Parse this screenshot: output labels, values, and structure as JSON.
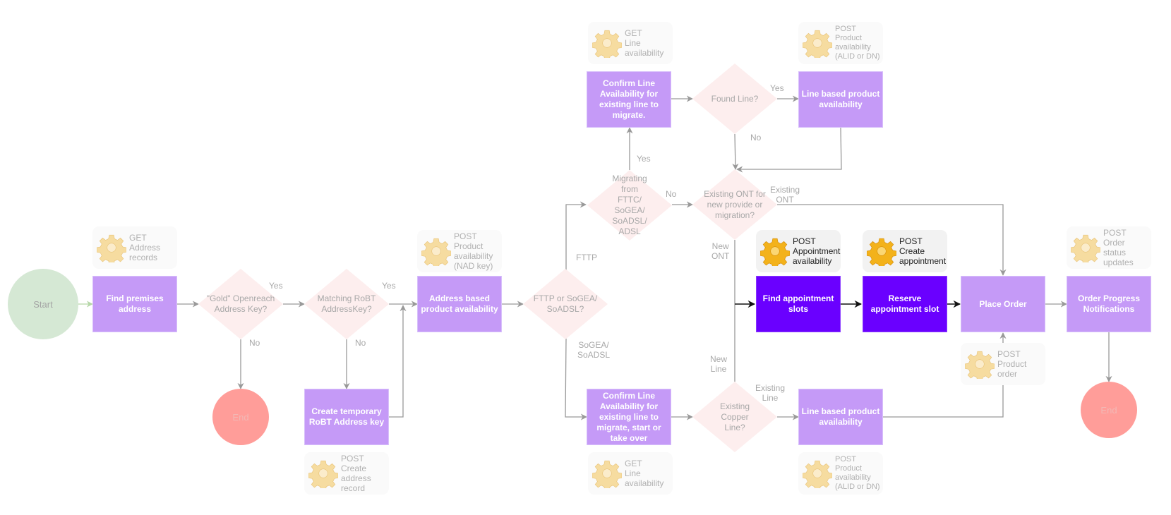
{
  "colors": {
    "process": "#c59af7",
    "process_active": "#6a00ff",
    "decision": "#fdeeee",
    "start": "#d5e8d4",
    "end": "#ff9d99",
    "connector": "#999999"
  },
  "terminals": {
    "start": "Start",
    "end_address": "End",
    "end_final": "End"
  },
  "processes": {
    "find_premises": "Find premises address",
    "create_temp_key": "Create temporary RoBT Address key",
    "address_availability": "Address based product availability",
    "confirm_line_migrate": "Confirm Line Availability for existing line to migrate.",
    "line_availability_top": "Line based product availability",
    "confirm_line_start": "Confirm Line Availability for existing line to migrate, start or take over",
    "line_availability_bottom": "Line based product availability",
    "find_slots": "Find appointment slots",
    "reserve_slot": "Reserve appointment slot",
    "place_order": "Place Order",
    "order_notifications": "Order Progress Notifications"
  },
  "decisions": {
    "gold_key": "\"Gold\" Openreach Address Key?",
    "matching_robt": "Matching RoBT AddressKey?",
    "fttp_or_sogea": "FTTP or SoGEA/ SoADSL?",
    "migrating_from": "Migrating from FTTC/ SoGEA/ SoADSL/ ADSL",
    "found_line": "Found Line?",
    "existing_ont": "Existing ONT for new provide or migration?",
    "existing_copper": "Existing Copper Line?"
  },
  "edge_labels": {
    "gold_yes": "Yes",
    "gold_no": "No",
    "robt_yes": "Yes",
    "robt_no": "No",
    "fttp": "FTTP",
    "sogea": "SoGEA/\nSoADSL",
    "migrating_yes": "Yes",
    "migrating_no": "No",
    "found_yes": "Yes",
    "found_no": "No",
    "existing_ont": "Existing\nONT",
    "new_ont": "New\nONT",
    "new_line": "New\nLine",
    "existing_line": "Existing\nLine"
  },
  "api_calls": [
    {
      "id": "get_address",
      "text": "GET\nAddress\nrecords",
      "active": false
    },
    {
      "id": "post_create_address",
      "text": "POST\nCreate\naddress\nrecord",
      "active": false
    },
    {
      "id": "post_product_nad",
      "text": "POST\nProduct\navailability\n(NAD key)",
      "active": false
    },
    {
      "id": "get_line_top",
      "text": "GET\nLine\navailability",
      "active": false
    },
    {
      "id": "post_product_alid_top",
      "text": "POST\nProduct\navailability\n(ALID or DN)",
      "active": false
    },
    {
      "id": "get_line_bottom",
      "text": "GET\nLine\navailability",
      "active": false
    },
    {
      "id": "post_product_alid_bottom",
      "text": "POST\nProduct\navailability\n(ALID or DN)",
      "active": false
    },
    {
      "id": "post_appointment_availability",
      "text": "POST\nAppointment\navailability",
      "active": true
    },
    {
      "id": "post_create_appointment",
      "text": "POST\nCreate\nappointment",
      "active": true
    },
    {
      "id": "post_product_order",
      "text": "POST\nProduct\norder",
      "active": false
    },
    {
      "id": "post_order_status",
      "text": "POST\nOrder\nstatus\nupdates",
      "active": false
    }
  ]
}
